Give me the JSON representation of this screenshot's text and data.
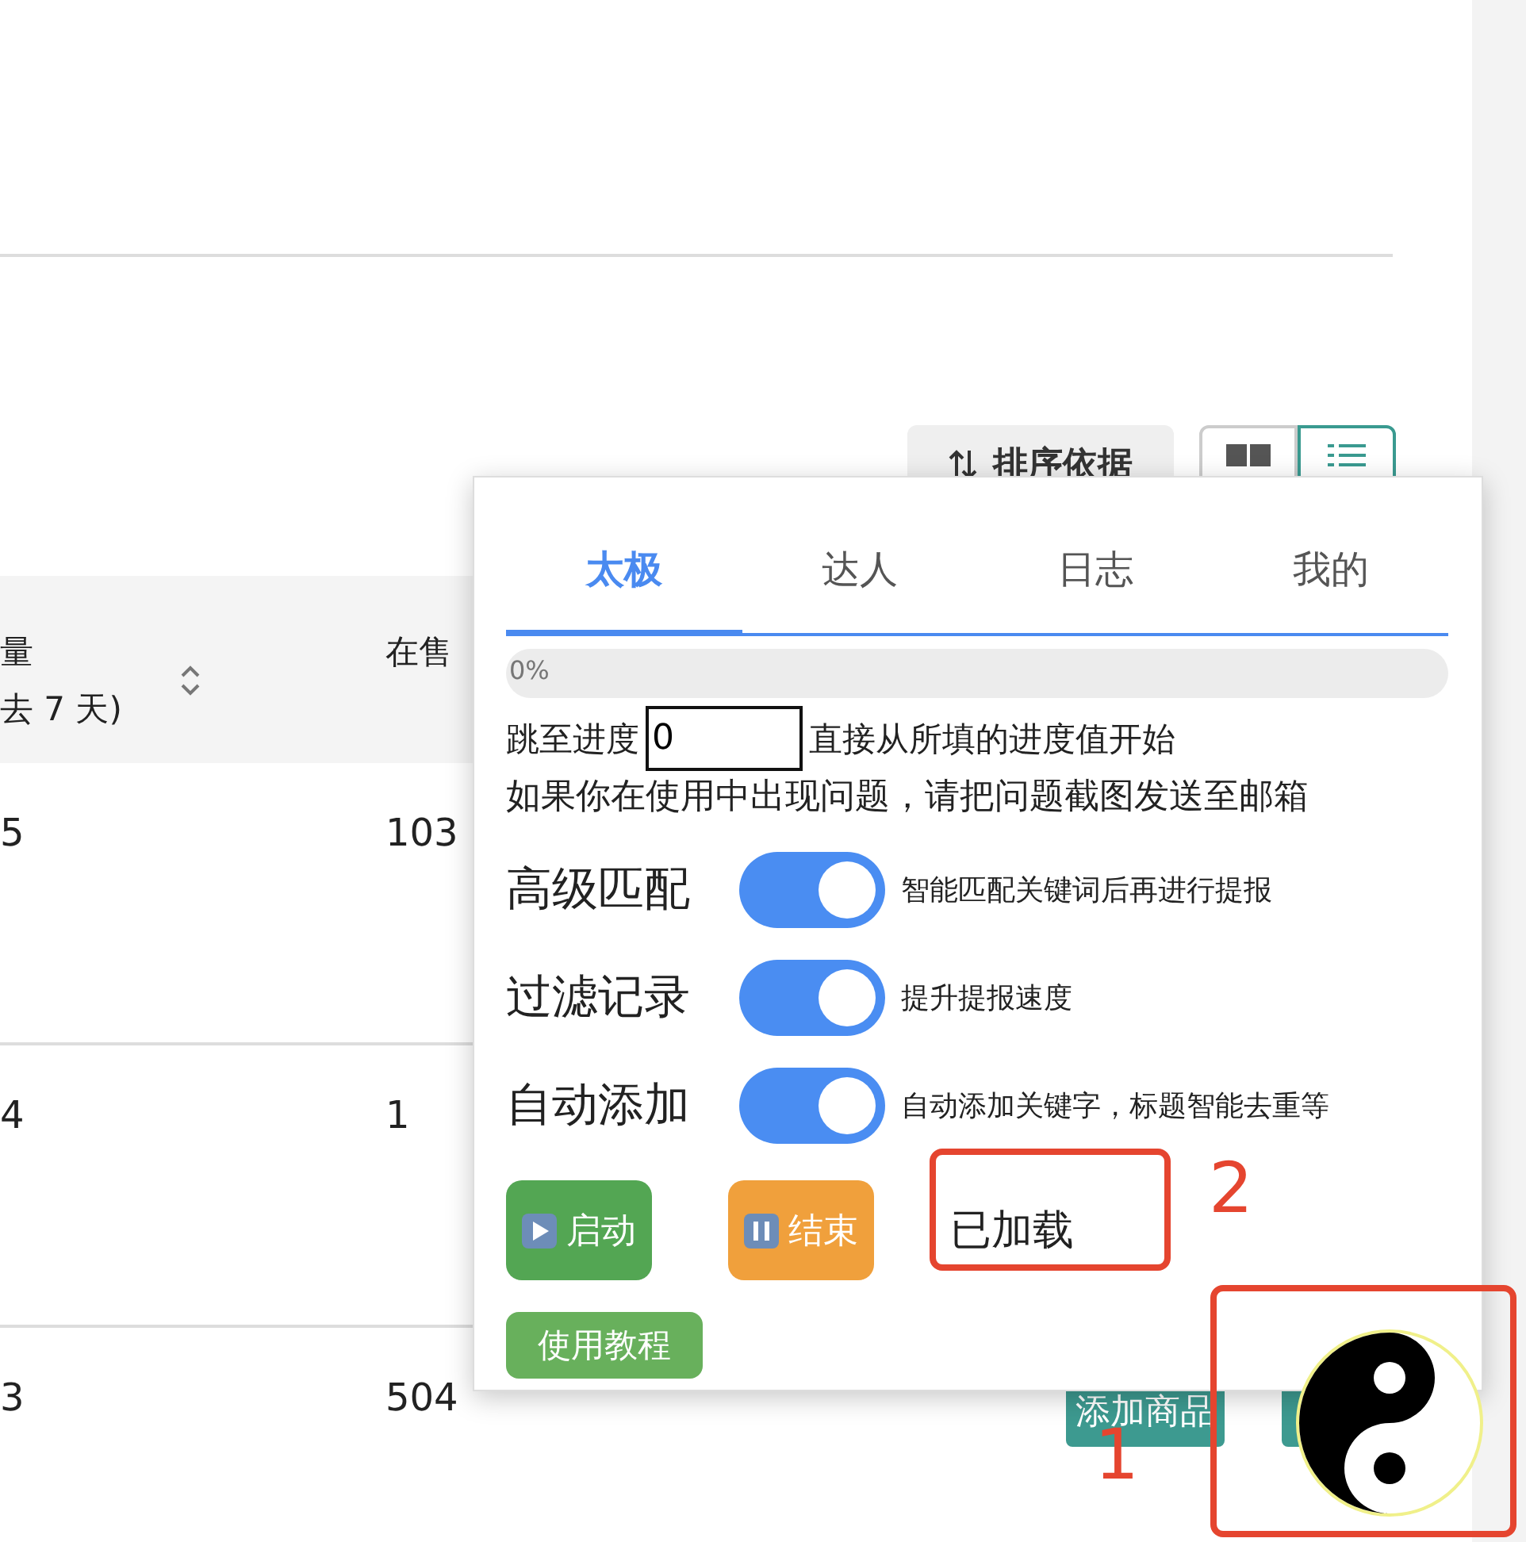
{
  "toolbar": {
    "sort_button": "排序依据",
    "views": [
      {
        "kind": "grid",
        "selected": false
      },
      {
        "kind": "list",
        "selected": true
      }
    ]
  },
  "table": {
    "columns": [
      {
        "lines": [
          "量",
          "去 7 天)"
        ],
        "sortable": true
      },
      {
        "lines": [
          "在售"
        ],
        "sortable": false
      }
    ],
    "rows": [
      [
        "5",
        "103"
      ],
      [
        "4",
        "1"
      ],
      [
        "3",
        "504"
      ]
    ]
  },
  "popup": {
    "tabs": [
      {
        "label": "太极",
        "selected": true
      },
      {
        "label": "达人",
        "selected": false
      },
      {
        "label": "日志",
        "selected": false
      },
      {
        "label": "我的",
        "selected": false
      }
    ],
    "progress": {
      "level": 0,
      "label": "0%"
    },
    "jump": {
      "label": "跳至进度",
      "value": "0",
      "hint": "直接从所填的进度值开始"
    },
    "notice": "如果你在使用中出现问题，请把问题截图发送至邮箱",
    "switches": [
      {
        "label": "高级匹配",
        "on": true,
        "description": "智能匹配关键词后再进行提报"
      },
      {
        "label": "过滤记录",
        "on": true,
        "description": "提升提报速度"
      },
      {
        "label": "自动添加",
        "on": true,
        "description": "自动添加关键字，标题智能去重等"
      }
    ],
    "actions": [
      {
        "kind": "start",
        "label": "启动"
      },
      {
        "kind": "stop",
        "label": "结束"
      }
    ],
    "status": "已加载",
    "tutorial_button": "使用教程"
  },
  "footer_buttons": [
    "添加商品"
  ],
  "annotations": [
    {
      "label": "1"
    },
    {
      "label": "2"
    }
  ]
}
